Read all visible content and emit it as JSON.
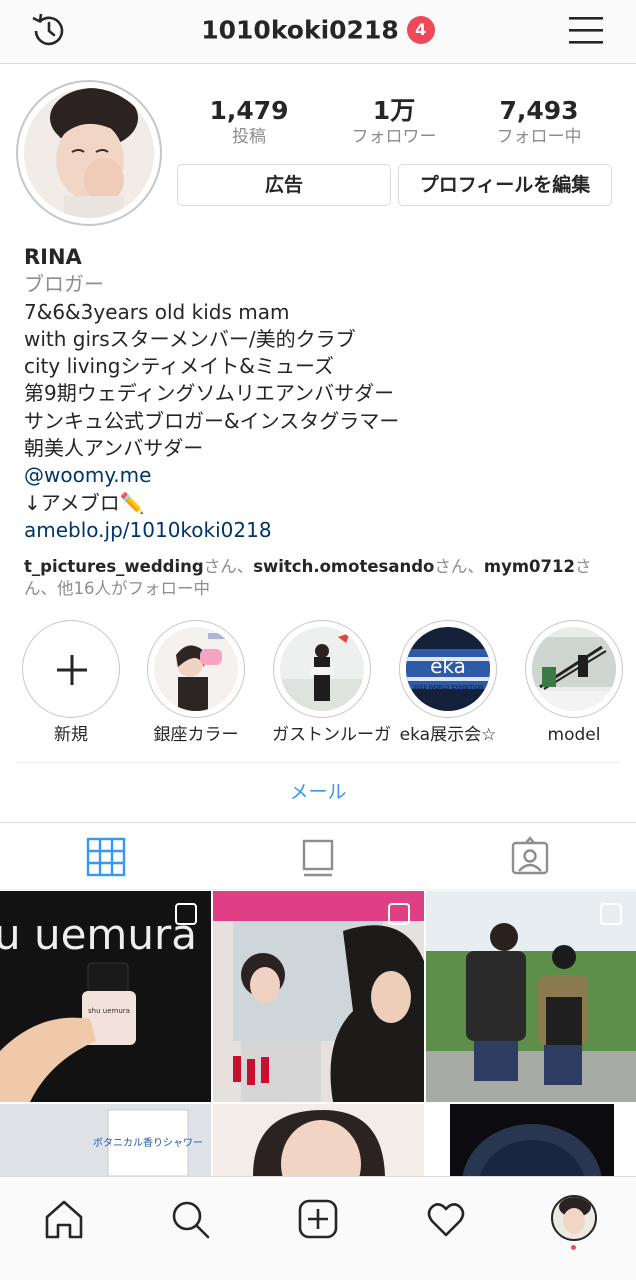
{
  "header": {
    "username": "1010koki0218",
    "notification_count": "4",
    "history_icon": "history-icon",
    "menu_icon": "menu-icon"
  },
  "profile": {
    "stats": [
      {
        "value": "1,479",
        "label": "投稿"
      },
      {
        "value": "1万",
        "label": "フォロワー"
      },
      {
        "value": "7,493",
        "label": "フォロー中"
      }
    ],
    "ad_button": "広告",
    "edit_button": "プロフィールを編集",
    "name": "RINA",
    "category": "ブロガー",
    "bio_lines": [
      "7&6&3years old kids mam",
      "with girsスターメンバー/美的クラブ",
      "city livingシティメイト&ミューズ",
      "第9期ウェディングソムリエアンバサダー",
      "サンキュ公式ブロガー&インスタグラマー",
      "朝美人アンバサダー"
    ],
    "mention": "@woomy.me",
    "ameblo_line": "↓アメブロ✏️",
    "website": "ameblo.jp/1010koki0218",
    "followed_by": {
      "user1": "t_pictures_wedding",
      "sep1": "さん、",
      "user2": "switch.omotesando",
      "sep2": "さん、",
      "user3": "mym0712",
      "rest": "さん、他16人がフォロー中"
    }
  },
  "highlights": [
    {
      "label": "新規"
    },
    {
      "label": "銀座カラー"
    },
    {
      "label": "ガストンルーガ"
    },
    {
      "label": "eka展示会☆"
    },
    {
      "label": "model"
    }
  ],
  "highlight_texts": {
    "eka": "eka",
    "exhibition": "2019 WORLD EXHIBITION"
  },
  "email_button": "メール",
  "tabs": [
    "grid-icon",
    "feed-icon",
    "tagged-icon"
  ],
  "posts": {
    "brand_text": "u uemura",
    "bottle_label": "shu uemura",
    "shower_label": "ボタニカル香りシャワー"
  },
  "bottom_nav": [
    "home-icon",
    "search-icon",
    "new-post-icon",
    "activity-icon",
    "profile-avatar"
  ],
  "colors": {
    "accent_blue": "#3897f0",
    "badge_red": "#ed4956",
    "link_blue": "#003569",
    "muted_gray": "#8e8e8e"
  }
}
